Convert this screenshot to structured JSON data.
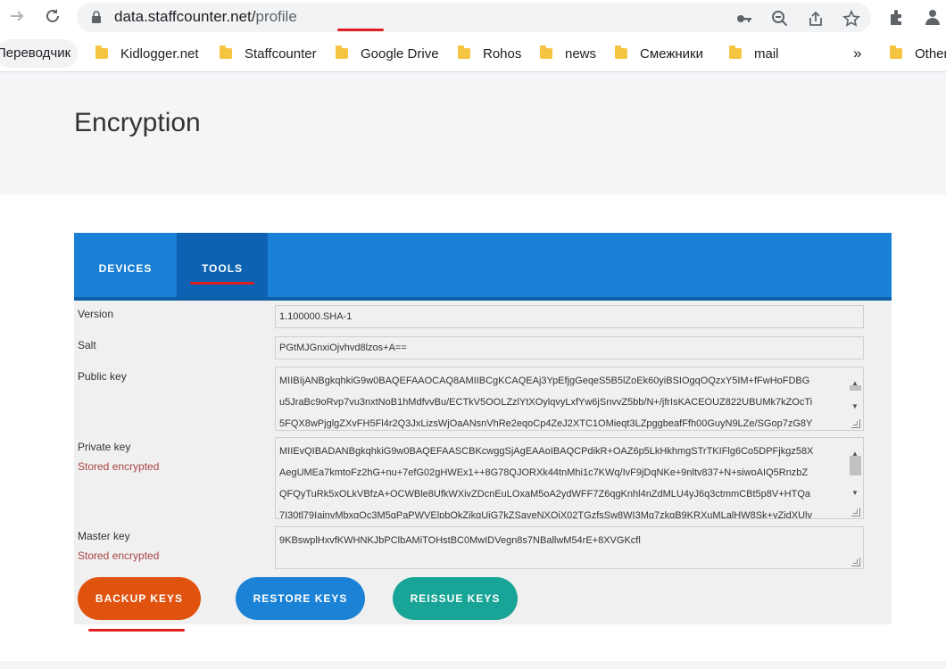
{
  "browser": {
    "url_domain": "data.staffcounter.net/",
    "url_path": "profile",
    "bookmarks": [
      {
        "label": "Переводчик"
      },
      {
        "label": "Kidlogger.net"
      },
      {
        "label": "Staffcounter"
      },
      {
        "label": "Google Drive"
      },
      {
        "label": "Rohos"
      },
      {
        "label": "news"
      },
      {
        "label": "Смежники"
      },
      {
        "label": "mail"
      }
    ],
    "overflow": "»",
    "other": "Other"
  },
  "page": {
    "title": "Encryption"
  },
  "tabs": [
    {
      "label": "DEVICES"
    },
    {
      "label": "TOOLS"
    }
  ],
  "fields": {
    "version": {
      "label": "Version",
      "value": "1.100000.SHA-1"
    },
    "salt": {
      "label": "Salt",
      "value": "PGtMJGnxiOjvhvd8lzos+A=="
    },
    "public_key": {
      "label": "Public key",
      "lines": [
        "MIIBIjANBgkqhkiG9w0BAQEFAAOCAQ8AMIIBCgKCAQEAj3YpEfjgGeqeS5B5lZoEk60yiBSIOgqOQzxY5IM+fFwHoFDBG",
        "u5JraBc9oRvp7vu3nxtNoB1hMdfvvBu/ECTkV5OOLZzlYtXOylqvyLxfYw6jSnvvZ5bb/N+/jfrIsKACEOUZ822UBUMk7kZOcTi",
        "5FQX8wPjglgZXvFH5Fl4r2Q3JxLizsWjOaANsnVhRe2eqoCp4ZeJ2XTC1OMieqt3LZpggbeafFfh00GuyN9LZe/SGop7zG8Y"
      ]
    },
    "private_key": {
      "label": "Private key",
      "note": "Stored encrypted",
      "lines": [
        "MIIEvQIBADANBgkqhkiG9w0BAQEFAASCBKcwggSjAgEAAoIBAQCPdikR+OAZ6p5LkHkhmgSTrTKIFlg6Co5DPFjkgz58X",
        "AegUMEa7kmtoFz2hG+nu+7efG02gHWEx1++8G78QJORXk44tnMhi1c7KWq/IvF9jDqNKe+9nltv837+N+siwoAIQ5RnzbZ",
        "QFQyTuRk5xOLkVBfzA+OCWBle8UfkWXivZDcnEuLOxaM5oA2ydWFF7Z6qgKnhl4nZdMLU4yJ6q3ctmmCBt5p8V+HTQa",
        "7I30tl79IainvMbxgQc3M5gPaPWVElpbOkZjkqUjG7kZSaveNXQjX02TGzfsSw8WI3Mq7zkgB9KRXuMLalHW8Sk+vZjdXUlv"
      ]
    },
    "master_key": {
      "label": "Master key",
      "note": "Stored encrypted",
      "value": "9KBswplHxvfKWHNKJbPClbAMiTOHstBC0MwIDVegn8s7NBallwM54rE+8XVGKcfl"
    }
  },
  "buttons": {
    "backup": "BACKUP KEYS",
    "restore": "RESTORE KEYS",
    "reissue": "REISSUE KEYS"
  }
}
